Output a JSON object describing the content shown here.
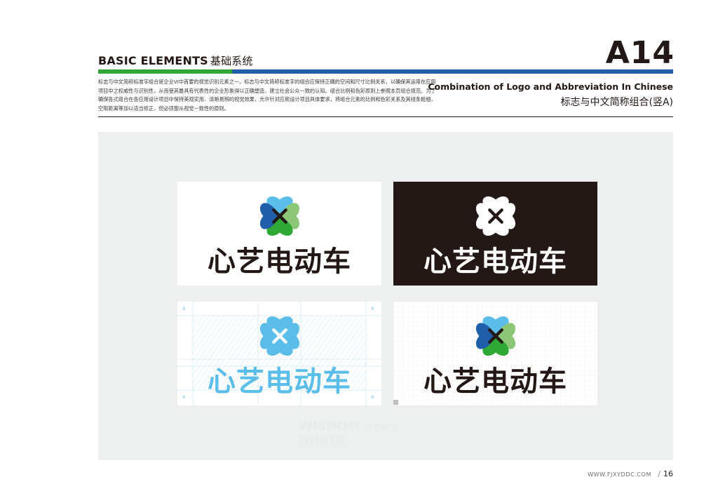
{
  "header": {
    "section_en": "BASIC ELEMENTS",
    "section_cn": "基础系统",
    "page_code": "A14"
  },
  "intro": {
    "text": "标志与中文简称标准字组合是企业VI中首要的视觉识别元素之一。标志与中文简称标准字的组合应保持正确的空间和尺寸比例关系，以确保其运用在应用项目中之权威性与识别性，从而使其最具有代表性的企业形象得以正确塑造，建立社会公众一致的认知。组合比例和色彩原则上参照本页组合规范。为了确保各式组合在各应用设计项目中保持美观实用、清晰易辨的视觉效果，允许针对应用设计项目具体要求，将组合元素的比例和色彩关系及其线条粗细，空隙距离等加以适当修正，但必须服从视觉一致性的原则。"
  },
  "title": {
    "en": "Combination of Logo and Abbreviation In Chinese",
    "cn": "标志与中文简称组合(竖A)"
  },
  "logo": {
    "wordmark": "心艺电动车",
    "icon": "four-heart-clover-icon"
  },
  "construction": {
    "marker": "x"
  },
  "watermark": {
    "line1": "WISDOM",
    "line1_cn": "众智联合",
    "line2": "UNION"
  },
  "footer": {
    "url": "WWW.FJXYDDC.COM",
    "page_number": "16"
  },
  "colors": {
    "green_bar": "#2fa836",
    "blue_bar": "#1f5ea8",
    "panel_bg": "#eef0ef",
    "dark_card": "#231815",
    "heart_blue_light": "#5bbde9",
    "heart_blue_dark": "#1f5ea8",
    "heart_green_light": "#8cc778",
    "heart_green_dark": "#2fa836",
    "construction_blue": "#5bbde9"
  }
}
